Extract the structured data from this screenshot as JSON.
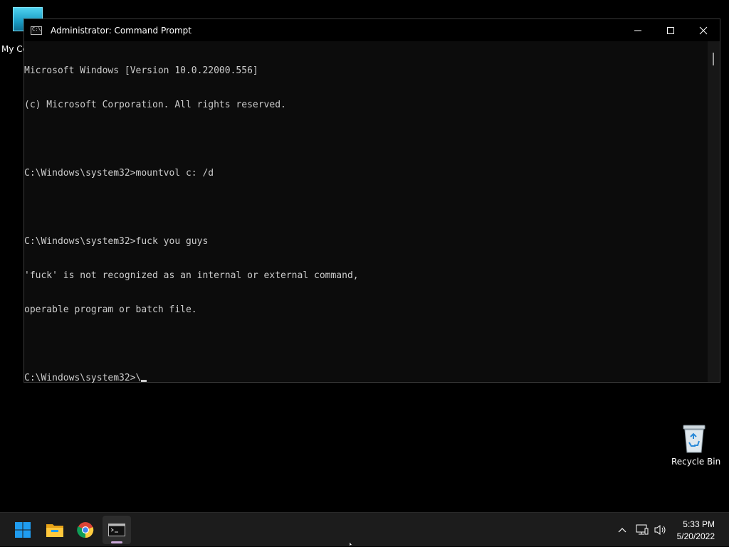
{
  "desktop": {
    "icons": [
      {
        "label": "My Co"
      },
      {
        "label": "Recycle Bin"
      }
    ]
  },
  "window": {
    "title": "Administrator: Command Prompt",
    "console_lines": [
      "Microsoft Windows [Version 10.0.22000.556]",
      "(c) Microsoft Corporation. All rights reserved.",
      "",
      "C:\\Windows\\system32>mountvol c: /d",
      "",
      "C:\\Windows\\system32>fuck you guys",
      "'fuck' is not recognized as an internal or external command,",
      "operable program or batch file.",
      "",
      "C:\\Windows\\system32>\\"
    ]
  },
  "taskbar": {
    "apps": [
      "start",
      "file-explorer",
      "chrome",
      "command-prompt"
    ],
    "active_app": "command-prompt",
    "clock": {
      "time": "5:33 PM",
      "date": "5/20/2022"
    }
  },
  "colors": {
    "console_bg": "#0c0c0c",
    "console_text": "#cccccc",
    "taskbar_bg": "#1c1c1c",
    "start_blue": "#1f9cf0"
  }
}
